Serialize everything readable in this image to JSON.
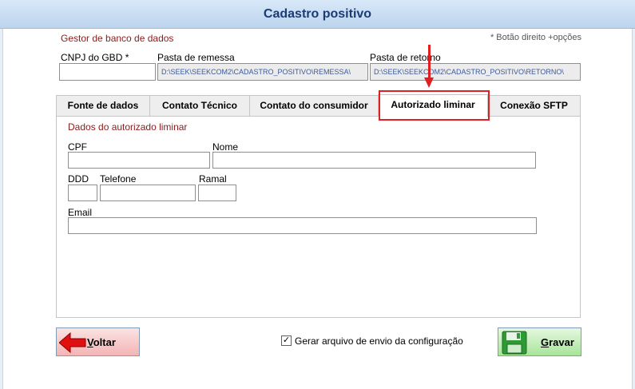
{
  "window": {
    "title": "Cadastro positivo"
  },
  "gbd": {
    "section_title": "Gestor de banco de dados",
    "hint": "* Botão direito +opções",
    "cnpj_label": "CNPJ do GBD *",
    "cnpj_value": "",
    "remessa_label": "Pasta de remessa",
    "remessa_value": "D:\\SEEK\\SEEKCOM2\\CADASTRO_POSITIVO\\REMESSA\\",
    "retorno_label": "Pasta de retorno",
    "retorno_value": "D:\\SEEK\\SEEKCOM2\\CADASTRO_POSITIVO\\RETORNO\\"
  },
  "tabs": [
    {
      "label": "Fonte de dados",
      "active": false
    },
    {
      "label": "Contato Técnico",
      "active": false
    },
    {
      "label": "Contato do consumidor",
      "active": false
    },
    {
      "label": "Autorizado liminar",
      "active": true
    },
    {
      "label": "Conexão SFTP",
      "active": false
    }
  ],
  "panel": {
    "title": "Dados do autorizado liminar",
    "cpf_label": "CPF",
    "cpf_value": "",
    "nome_label": "Nome",
    "nome_value": "",
    "ddd_label": "DDD",
    "ddd_value": "",
    "telefone_label": "Telefone",
    "telefone_value": "",
    "ramal_label": "Ramal",
    "ramal_value": "",
    "email_label": "Email",
    "email_value": ""
  },
  "footer": {
    "back_first": "V",
    "back_rest": "oltar",
    "checkbox_checked": true,
    "checkbox_label": "Gerar arquivo de envio da configuração",
    "save_first": "G",
    "save_rest": "ravar"
  },
  "colors": {
    "annotation": "#e02020",
    "section_title": "#8b1a1a",
    "title_text": "#1a3b73"
  }
}
